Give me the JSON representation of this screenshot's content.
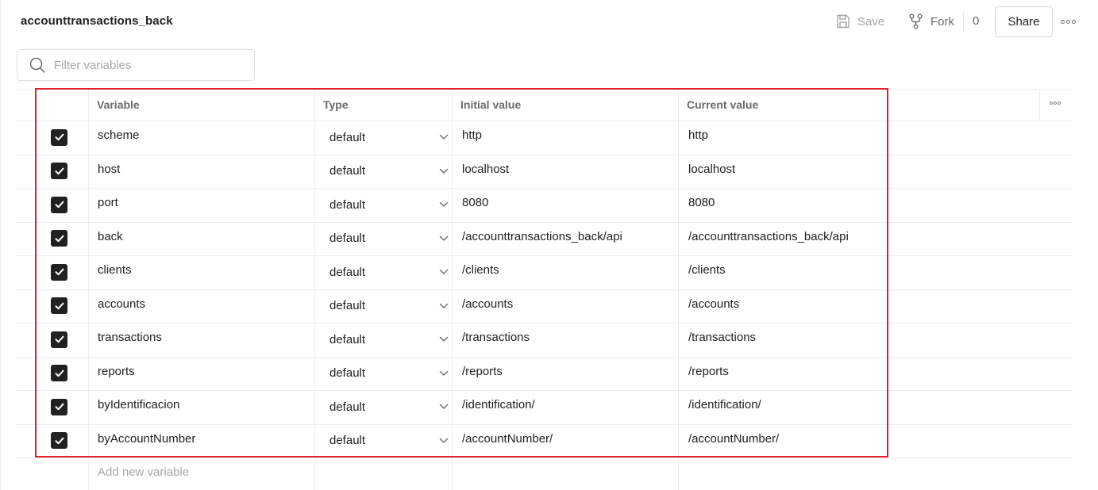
{
  "header": {
    "title": "accounttransactions_back",
    "save_label": "Save",
    "fork_label": "Fork",
    "fork_count": "0",
    "share_label": "Share"
  },
  "filter": {
    "placeholder": "Filter variables",
    "value": ""
  },
  "table": {
    "columns": [
      "Variable",
      "Type",
      "Initial value",
      "Current value"
    ],
    "rows": [
      {
        "enabled": true,
        "variable": "scheme",
        "type": "default",
        "initial": "http",
        "current": "http"
      },
      {
        "enabled": true,
        "variable": "host",
        "type": "default",
        "initial": "localhost",
        "current": "localhost"
      },
      {
        "enabled": true,
        "variable": "port",
        "type": "default",
        "initial": "8080",
        "current": "8080"
      },
      {
        "enabled": true,
        "variable": "back",
        "type": "default",
        "initial": "/accounttransactions_back/api",
        "current": "/accounttransactions_back/api"
      },
      {
        "enabled": true,
        "variable": "clients",
        "type": "default",
        "initial": "/clients",
        "current": "/clients"
      },
      {
        "enabled": true,
        "variable": "accounts",
        "type": "default",
        "initial": "/accounts",
        "current": "/accounts"
      },
      {
        "enabled": true,
        "variable": "transactions",
        "type": "default",
        "initial": "/transactions",
        "current": "/transactions"
      },
      {
        "enabled": true,
        "variable": "reports",
        "type": "default",
        "initial": "/reports",
        "current": "/reports"
      },
      {
        "enabled": true,
        "variable": "byIdentificacion",
        "type": "default",
        "initial": "/identification/",
        "current": "/identification/"
      },
      {
        "enabled": true,
        "variable": "byAccountNumber",
        "type": "default",
        "initial": "/accountNumber/",
        "current": "/accountNumber/"
      }
    ],
    "add_placeholder": "Add new variable"
  },
  "colors": {
    "highlight": "#e1202b",
    "checkbox": "#212121"
  },
  "icons": {
    "save": "save-icon",
    "fork": "fork-icon",
    "more": "more-horizontal-icon",
    "search": "search-icon",
    "check": "check-icon",
    "dropdown": "chevron-down-icon"
  }
}
